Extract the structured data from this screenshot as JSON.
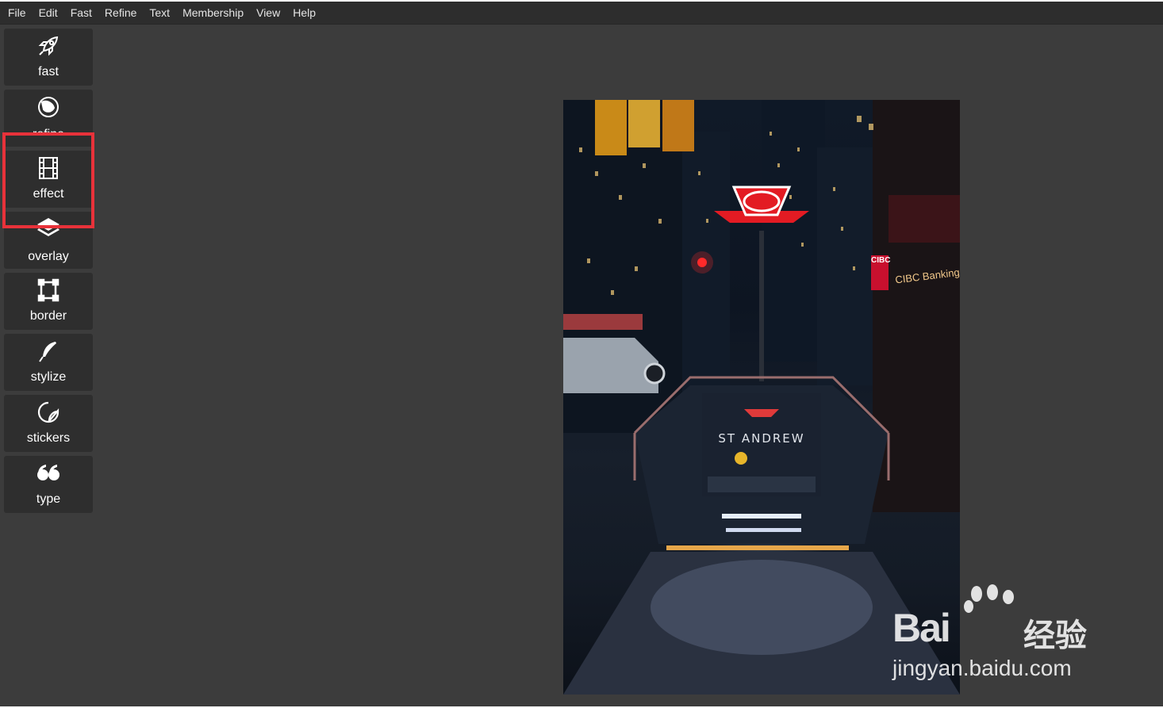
{
  "menubar": {
    "items": [
      "File",
      "Edit",
      "Fast",
      "Refine",
      "Text",
      "Membership",
      "View",
      "Help"
    ]
  },
  "tools": [
    {
      "label": "fast",
      "icon": "rocket-icon"
    },
    {
      "label": "refine",
      "icon": "circles-icon"
    },
    {
      "label": "effect",
      "icon": "film-strip-icon"
    },
    {
      "label": "overlay",
      "icon": "layers-icon"
    },
    {
      "label": "border",
      "icon": "frame-icon"
    },
    {
      "label": "stylize",
      "icon": "feather-icon"
    },
    {
      "label": "stickers",
      "icon": "sticker-icon"
    },
    {
      "label": "type",
      "icon": "quote-icon"
    }
  ],
  "photo": {
    "station_sign": "ST ANDREW",
    "bank_sign": "CIBC Banking Centre",
    "bank_logo": "CIBC"
  },
  "watermark": {
    "brand": "Bai",
    "brand_cn": "经验",
    "url": "jingyan.baidu.com"
  },
  "colors": {
    "background": "#3c3c3c",
    "menubar": "#2d2d2d",
    "tool_button": "#2e2e2e",
    "highlight": "#e8323a"
  }
}
